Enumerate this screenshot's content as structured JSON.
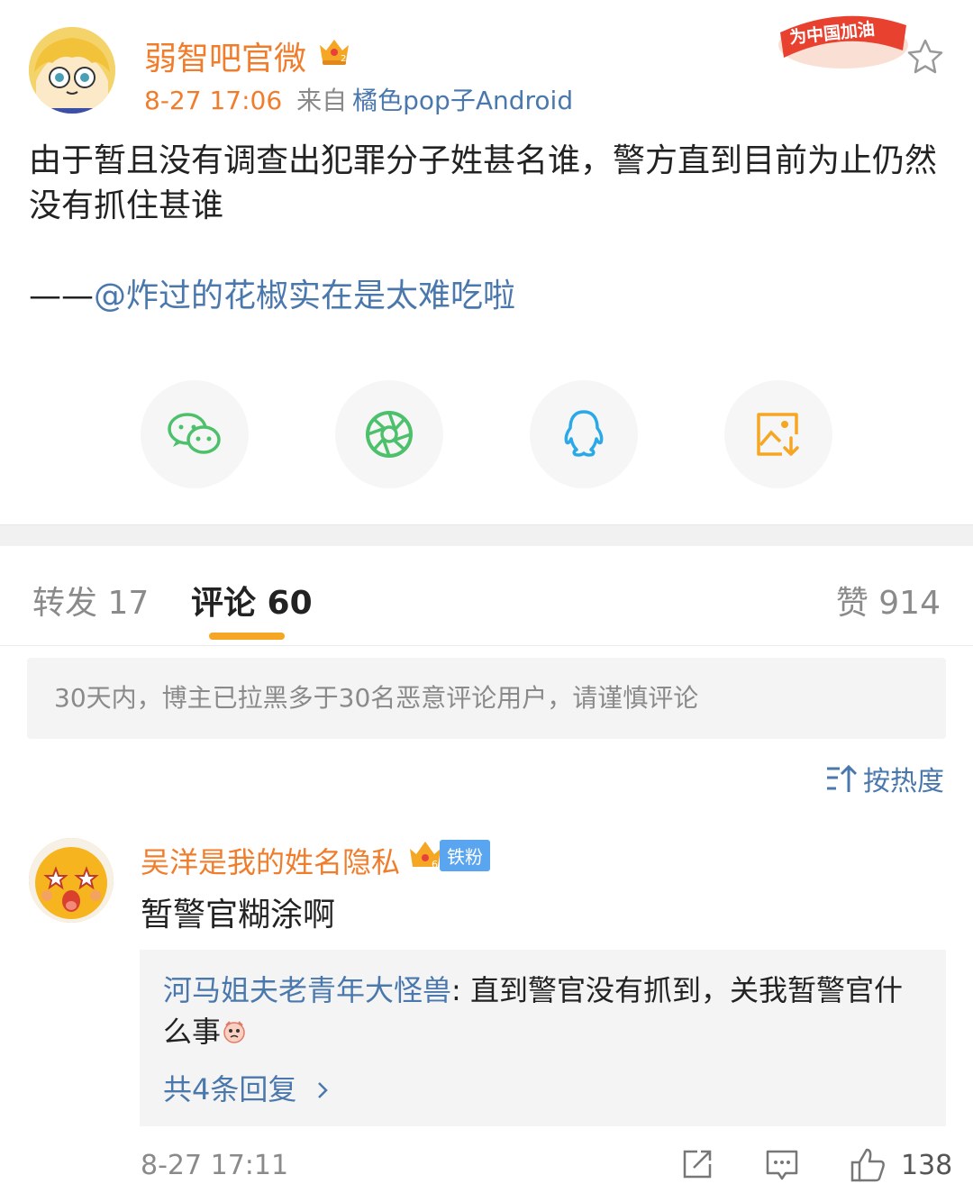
{
  "post": {
    "author": "弱智吧官微",
    "time": "8-27 17:06",
    "from_label": "来自",
    "source": "橘色pop子Android",
    "promo_badge": "为中国加油",
    "text": "由于暂且没有调查出犯罪分子姓甚名谁，警方直到目前为止仍然没有抓住甚谁",
    "credit_dash": "——",
    "credit_mention": "@炸过的花椒实在是太难吃啦"
  },
  "share": {
    "items": [
      "wechat-icon",
      "moments-icon",
      "qq-icon",
      "save-image-icon"
    ]
  },
  "tabs": {
    "repost": "转发 17",
    "comments": "评论 60",
    "likes": "赞 914"
  },
  "notice": "30天内，博主已拉黑多于30名恶意评论用户，请谨慎评论",
  "sort_label": "按热度",
  "comment": {
    "author": "吴洋是我的姓名隐私",
    "badge": "铁粉",
    "text": "暂警官糊涂啊",
    "reply_user": "河马姐夫老青年大怪兽",
    "reply_text": ": 直到警官没有抓到，关我暂警官什么事",
    "more_replies": "共4条回复",
    "time": "8-27 17:11",
    "likes": "138"
  },
  "colors": {
    "accent_orange": "#f07d2c",
    "link_blue": "#4a78ad",
    "tab_underline": "#f5a623"
  }
}
